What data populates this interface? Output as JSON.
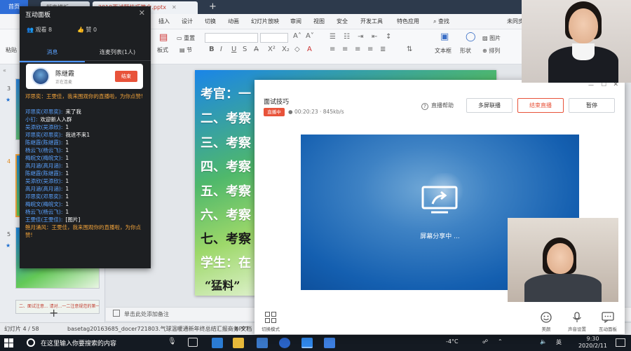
{
  "wps": {
    "tabs": {
      "home": "首页",
      "doc1": "稻壳模板",
      "doc2": "2019面试题技巧简介.pptx"
    },
    "menu": [
      "插入",
      "设计",
      "切换",
      "动画",
      "幻灯片放映",
      "审阅",
      "视图",
      "安全",
      "开发工具",
      "特色应用",
      "查找",
      "未同步"
    ],
    "ribbon": {
      "paste": "粘贴",
      "reset": "重置",
      "section": "节",
      "board": "板式",
      "textbox": "文本框",
      "shape": "形状",
      "picture": "图片",
      "arrange": "排列"
    },
    "slides_panel": {
      "items": [
        "3",
        "4",
        "5"
      ],
      "thumb4_title": "二、面试注意... 请对...一二注意规范的第一..."
    },
    "slide": {
      "lines": [
        "考官：一",
        "二、考察",
        "三、考察",
        "四、考察",
        "五、考察",
        "六、考察",
        "七、考察",
        "学生：在",
        "“猛料”"
      ]
    },
    "notes_placeholder": "单击此处添加备注",
    "status": {
      "slide_counter": "幻灯片 4 / 58",
      "template": "basetag20163685_docer721803.气球温暖通新年终总结汇报商务PPT",
      "doc_tab": "文档"
    },
    "taskbar": {
      "search_placeholder": "在这里输入你要搜索的内容",
      "temperature": "-4°C",
      "ime": "英",
      "time": "9:30",
      "date": "2020/2/11"
    }
  },
  "panel": {
    "title": "互动面板",
    "viewers": "观看 8",
    "likes": "赞 0",
    "tabs": [
      "消息",
      "连麦列表(1人)"
    ],
    "host": {
      "name": "陈继霞",
      "status": "正在连麦",
      "end_label": "结束"
    },
    "chat": [
      {
        "type": "sys",
        "text": "邓思奕：王雯佳，我来围观你的直播啦，为你点赞!"
      },
      {
        "type": "msg",
        "who": "邓思奕(邓思奕):",
        "msg": "来了我"
      },
      {
        "type": "msg",
        "who": "小钉:",
        "msg": "欢迎新人入群"
      },
      {
        "type": "msg",
        "who": "吴添欣(吴添欣):",
        "msg": "1"
      },
      {
        "type": "msg",
        "who": "邓思奕(邓思奕):",
        "msg": "我进不来1"
      },
      {
        "type": "msg",
        "who": "陈继霞(陈继霞):",
        "msg": "1"
      },
      {
        "type": "msg",
        "who": "杨云飞(杨云飞):",
        "msg": "1"
      },
      {
        "type": "msg",
        "who": "梅皖文(梅皖文):",
        "msg": "1"
      },
      {
        "type": "msg",
        "who": "高月涵(高月涵):",
        "msg": "1"
      },
      {
        "type": "msg",
        "who": "陈继霞(陈继霞):",
        "msg": "1"
      },
      {
        "type": "msg",
        "who": "吴添欣(吴添欣):",
        "msg": "1"
      },
      {
        "type": "msg",
        "who": "高月涵(高月涵):",
        "msg": "1"
      },
      {
        "type": "msg",
        "who": "邓思奕(邓思奕):",
        "msg": "1"
      },
      {
        "type": "msg",
        "who": "梅皖文(梅皖文):",
        "msg": "1"
      },
      {
        "type": "msg",
        "who": "杨云飞(杨云飞):",
        "msg": "1"
      },
      {
        "type": "msg",
        "who": "王雯佳(王雯佳):",
        "msg": "[图片]"
      },
      {
        "type": "sys",
        "text": "鲍月涌风：王雯佳，我来围观你的直播啦，为你点赞!"
      }
    ]
  },
  "share": {
    "title": "面试技巧",
    "live_badge": "直播中",
    "elapsed": "00:20:23",
    "bitrate": "845kb/s",
    "help": "直播帮助",
    "buttons": {
      "multi": "多屏联播",
      "end": "结束直播",
      "pause": "暂停"
    },
    "sharing": "屏幕分享中 ...",
    "tools": {
      "layout": "切换模式",
      "beauty": "美颜",
      "audio": "声音设置",
      "interact": "互动面板"
    }
  },
  "colors": {
    "accent_blue": "#4d96ff",
    "live_red": "#e8533a",
    "panel_bg": "#1d1f22"
  }
}
